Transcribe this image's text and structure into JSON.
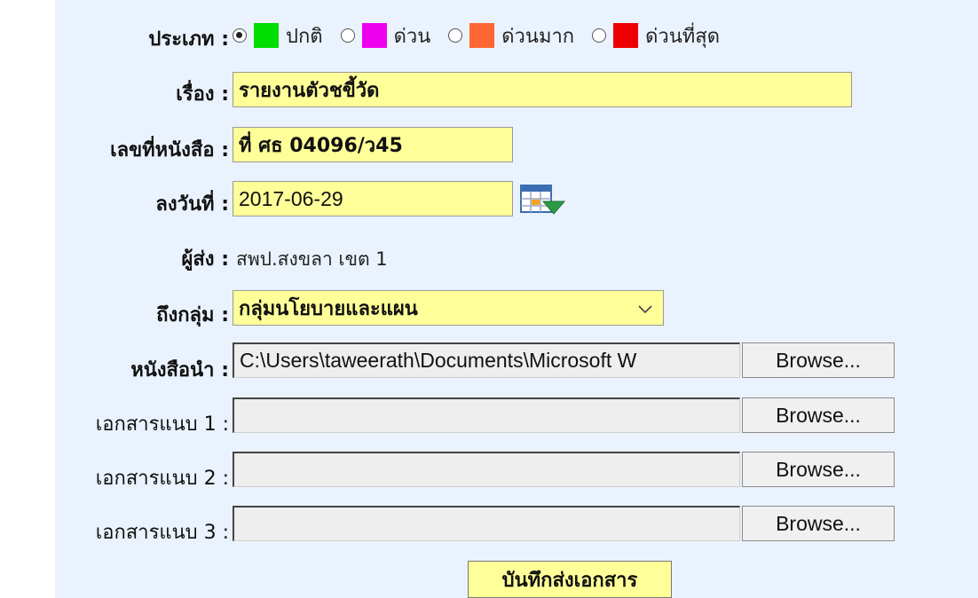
{
  "type_label": "ประเภท :",
  "type_options": [
    {
      "label": "ปกติ",
      "color": "#00dd00",
      "checked": true
    },
    {
      "label": "ด่วน",
      "color": "#ee00ee",
      "checked": false
    },
    {
      "label": "ด่วนมาก",
      "color": "#ff6633",
      "checked": false
    },
    {
      "label": "ด่วนที่สุด",
      "color": "#ee0000",
      "checked": false
    }
  ],
  "subject": {
    "label": "เรื่อง :",
    "value": "รายงานตัวชขี้วัด"
  },
  "doc_number": {
    "label": "เลขที่หนังสือ :",
    "value": "ที่ ศธ 04096/ว45"
  },
  "date": {
    "label": "ลงวันที่ :",
    "value": "2017-06-29",
    "icon": "calendar-icon"
  },
  "sender": {
    "label": "ผู้ส่ง :",
    "value": "สพป.สงขลา เขต 1"
  },
  "to_group": {
    "label": "ถึงกลุ่ม :",
    "value": "กลุ่มนโยบายและแผน"
  },
  "cover_letter": {
    "label": "หนังสือนำ :",
    "value": "C:\\Users\\taweerath\\Documents\\Microsoft W",
    "button": "Browse..."
  },
  "attachments": [
    {
      "label": "เอกสารแนบ 1 :",
      "value": "",
      "button": "Browse..."
    },
    {
      "label": "เอกสารแนบ 2 :",
      "value": "",
      "button": "Browse..."
    },
    {
      "label": "เอกสารแนบ 3 :",
      "value": "",
      "button": "Browse..."
    }
  ],
  "submit_label": "บันทึกส่งเอกสาร",
  "colors": {
    "panel_bg": "#eaf2fd",
    "field_bg": "#ffff99",
    "file_bg": "#eeeeee"
  }
}
